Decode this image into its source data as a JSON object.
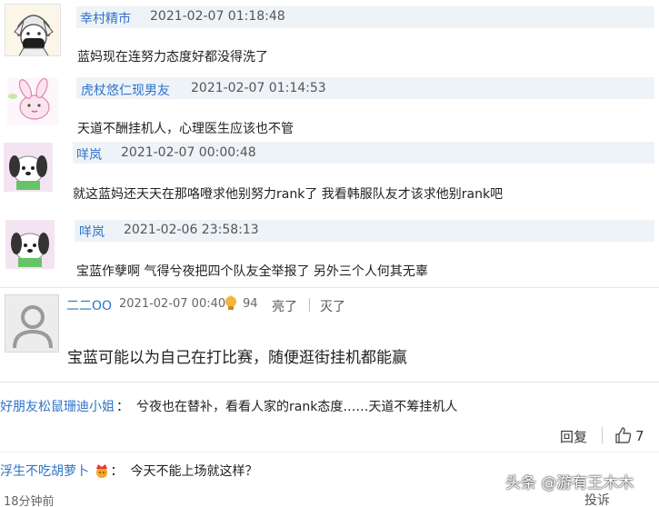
{
  "comments": [
    {
      "user": "幸村精市",
      "time": "2021-02-07 01:18:48",
      "text": "蓝妈现在连努力态度好都没得洗了",
      "avatar": "masked-anime-avatar"
    },
    {
      "user": "虎杖悠仁现男友",
      "time": "2021-02-07 01:14:53",
      "text": "天道不酬挂机人，心理医生应该也不管",
      "avatar": "bunny-avatar"
    },
    {
      "user": "咩岚",
      "time": "2021-02-07 00:00:48",
      "text": "就这蓝妈还天天在那咯噔求他别努力rank了 我看韩服队友才该求他别rank吧",
      "avatar": "plush-dog-avatar"
    },
    {
      "user": "咩岚",
      "time": "2021-02-06 23:58:13",
      "text": "宝蓝作孽啊 气得兮夜把四个队友全举报了 另外三个人何其无辜",
      "avatar": "plush-dog-avatar"
    }
  ],
  "main_comment": {
    "user": "二二OO",
    "time": "2021-02-07 00:40",
    "likes": "94",
    "like_label": "亮了",
    "dislike_label": "灭了",
    "text": "宝蓝可能以为自己在打比赛，随便逛街挂机都能赢"
  },
  "replies": [
    {
      "user": "好朋友松鼠珊迪小姐",
      "sep": "：",
      "text": "兮夜也在替补，看看人家的rank态度……天道不筹挂机人"
    },
    {
      "user": "浮生不吃胡萝卜",
      "sep": "：",
      "text": "今天不能上场就这样？"
    }
  ],
  "actions": {
    "reply": "回复",
    "thumb_count": "7",
    "report": "投诉"
  },
  "footer": {
    "time_ago": "18分钟前"
  },
  "watermark": "头条 @游有王木木",
  "colors": {
    "username": "#2e73c9",
    "meta_bar": "#eef3f8",
    "bulb": "#f2b63a"
  }
}
